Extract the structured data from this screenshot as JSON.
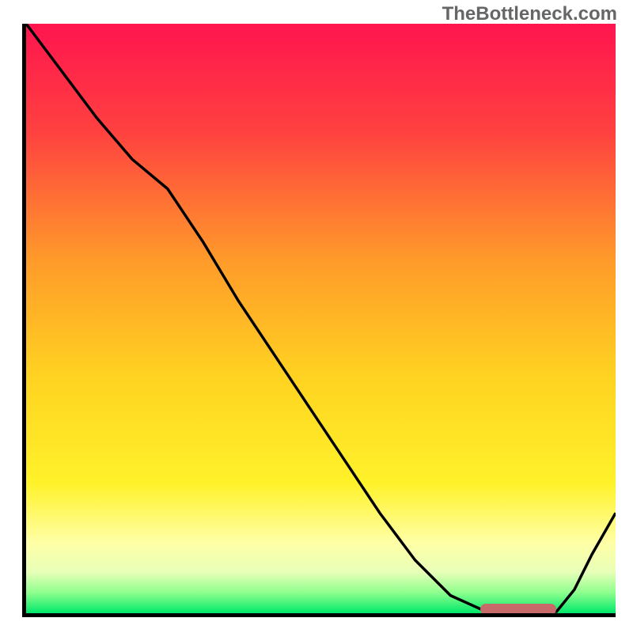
{
  "watermark": "TheBottleneck.com",
  "chart_data": {
    "type": "line",
    "x": [
      0.0,
      0.06,
      0.12,
      0.18,
      0.24,
      0.3,
      0.36,
      0.42,
      0.48,
      0.54,
      0.6,
      0.66,
      0.72,
      0.78,
      0.81,
      0.84,
      0.87,
      0.9,
      0.93,
      0.96,
      1.0
    ],
    "values": [
      1.0,
      0.92,
      0.84,
      0.77,
      0.72,
      0.63,
      0.53,
      0.44,
      0.35,
      0.26,
      0.17,
      0.09,
      0.03,
      0.003,
      0.0,
      0.0,
      0.0,
      0.003,
      0.04,
      0.1,
      0.17
    ],
    "ylim": [
      0,
      1
    ],
    "xlim": [
      0,
      1
    ],
    "gradient_stops": [
      {
        "pos": 0.0,
        "color": "#ff154f"
      },
      {
        "pos": 0.18,
        "color": "#ff4040"
      },
      {
        "pos": 0.4,
        "color": "#ff9a2a"
      },
      {
        "pos": 0.6,
        "color": "#ffd321"
      },
      {
        "pos": 0.78,
        "color": "#fff22a"
      },
      {
        "pos": 0.88,
        "color": "#ffffa6"
      },
      {
        "pos": 0.93,
        "color": "#e8ffb8"
      },
      {
        "pos": 0.965,
        "color": "#8eff8e"
      },
      {
        "pos": 1.0,
        "color": "#00e86a"
      }
    ],
    "marker": {
      "x_start": 0.77,
      "x_end": 0.9,
      "y": 0.0,
      "color": "#c96a6a"
    },
    "title": "",
    "xlabel": "",
    "ylabel": ""
  }
}
